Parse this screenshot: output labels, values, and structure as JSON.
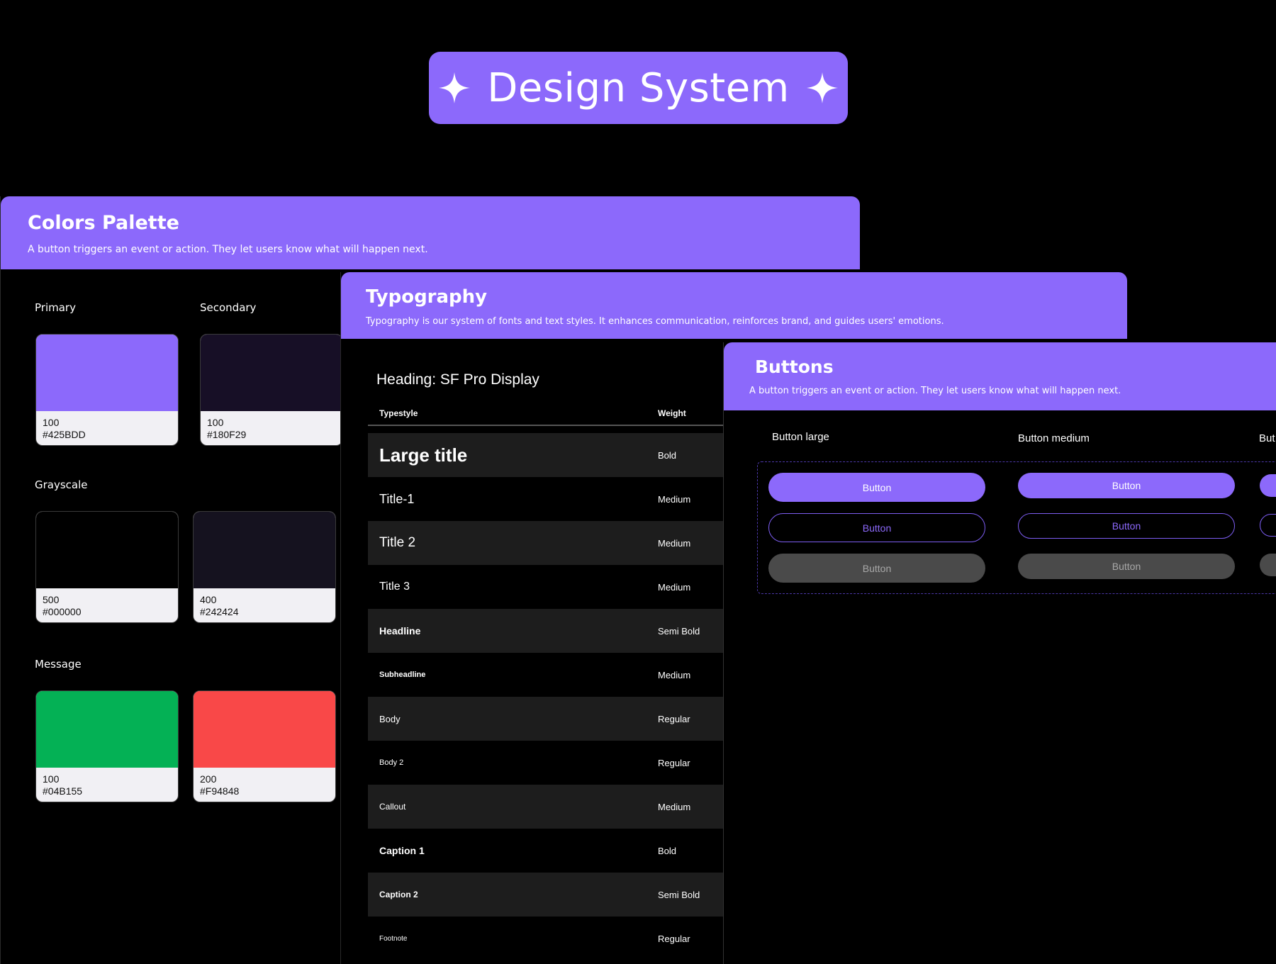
{
  "header": {
    "title": "Design System",
    "left_icon": "sparkle-icon",
    "right_icon": "sparkle-icon"
  },
  "colors": {
    "title": "Colors Palette",
    "description": "A button triggers an event or action. They let users know what will happen next.",
    "groups": {
      "primary": {
        "label": "Primary",
        "swatch": {
          "shade": "100",
          "hex": "#425BDD",
          "display_color": "#8c69fb"
        }
      },
      "secondary": {
        "label": "Secondary",
        "swatch": {
          "shade": "100",
          "hex": "#180F29",
          "display_color": "#170f26"
        }
      },
      "grayscale": {
        "label": "Grayscale",
        "swatches": [
          {
            "shade": "500",
            "hex": "#000000",
            "display_color": "#000000"
          },
          {
            "shade": "400",
            "hex": "#242424",
            "display_color": "#15121f"
          }
        ]
      },
      "message": {
        "label": "Message",
        "swatches": [
          {
            "shade": "100",
            "hex": "#04B155",
            "display_color": "#04b155"
          },
          {
            "shade": "200",
            "hex": "#F94848",
            "display_color": "#f94848"
          }
        ]
      }
    }
  },
  "typography": {
    "title": "Typography",
    "description": "Typography is our system of fonts and text styles. It enhances communication, reinforces brand, and guides users' emotions.",
    "heading": "Heading: SF Pro Display",
    "columns": {
      "typestyle": "Typestyle",
      "weight": "Weight"
    },
    "rows": [
      {
        "name": "Large title",
        "weight": "Bold"
      },
      {
        "name": "Title-1",
        "weight": "Medium"
      },
      {
        "name": "Title 2",
        "weight": "Medium"
      },
      {
        "name": "Title 3",
        "weight": "Medium"
      },
      {
        "name": "Headline",
        "weight": "Semi Bold"
      },
      {
        "name": "Subheadline",
        "weight": "Medium"
      },
      {
        "name": "Body",
        "weight": "Regular"
      },
      {
        "name": "Body 2",
        "weight": "Regular"
      },
      {
        "name": "Callout",
        "weight": "Medium"
      },
      {
        "name": "Caption 1",
        "weight": "Bold"
      },
      {
        "name": "Caption 2",
        "weight": "Semi Bold"
      },
      {
        "name": "Footnote",
        "weight": "Regular"
      }
    ]
  },
  "buttons": {
    "title": "Buttons",
    "description": "A button triggers an event or action. They let users know what will happen next.",
    "columns": [
      "Button large",
      "Button medium",
      "But"
    ],
    "button_label": "Button",
    "variants": [
      "primary",
      "outline",
      "disabled"
    ]
  },
  "colors_accent": {
    "brand": "#8c69fb",
    "panel_bg": "#000000",
    "row_dark": "#1d1d1d"
  }
}
